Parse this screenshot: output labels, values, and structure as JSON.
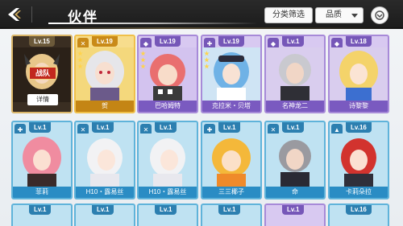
{
  "header": {
    "title": "伙伴",
    "filter_label": "分类筛选",
    "sort_label": "品质"
  },
  "row1": [
    {
      "lv": "Lv.15",
      "name": "",
      "rarity": "selected",
      "badge": "战队",
      "detail": "详情"
    },
    {
      "lv": "Lv.19",
      "name": "贺",
      "rarity": "gold"
    },
    {
      "lv": "Lv.19",
      "name": "巴哈姆特",
      "rarity": "purple"
    },
    {
      "lv": "Lv.19",
      "name": "克拉米・贝塔",
      "rarity": "purple"
    },
    {
      "lv": "Lv.1",
      "name": "名神龙二",
      "rarity": "purple"
    },
    {
      "lv": "Lv.18",
      "name": "诗黎黎",
      "rarity": "purple"
    }
  ],
  "row2": [
    {
      "lv": "Lv.1",
      "name": "菲莉",
      "rarity": "blue"
    },
    {
      "lv": "Lv.1",
      "name": "H10・露易丝",
      "rarity": "blue"
    },
    {
      "lv": "Lv.1",
      "name": "H10・露易丝",
      "rarity": "blue"
    },
    {
      "lv": "Lv.1",
      "name": "三三椰子",
      "rarity": "blue"
    },
    {
      "lv": "Lv.1",
      "name": "命",
      "rarity": "blue"
    },
    {
      "lv": "Lv.16",
      "name": "卡莉朵拉",
      "rarity": "blue"
    }
  ],
  "row3": [
    {
      "lv": "Lv.1",
      "rarity": "blue"
    },
    {
      "lv": "Lv.1",
      "rarity": "blue"
    },
    {
      "lv": "Lv.1",
      "rarity": "blue"
    },
    {
      "lv": "Lv.1",
      "rarity": "blue"
    },
    {
      "lv": "Lv.1",
      "rarity": "purple"
    },
    {
      "lv": "Lv.16",
      "rarity": "blue"
    }
  ]
}
